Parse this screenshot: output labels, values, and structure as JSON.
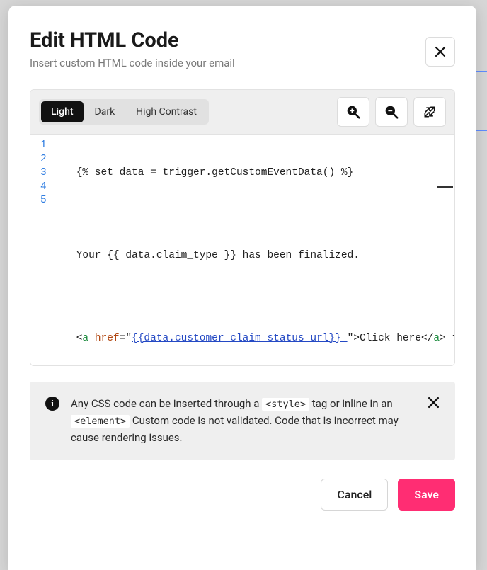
{
  "modal": {
    "title": "Edit HTML Code",
    "subtitle": "Insert custom HTML code inside your email"
  },
  "toolbar": {
    "themes": {
      "light": "Light",
      "dark": "Dark",
      "high_contrast": "High Contrast"
    }
  },
  "code": {
    "line1": "{% set data = trigger.getCustomEventData() %}",
    "line2": "",
    "line3": "Your {{ data.claim_type }} has been finalized.",
    "line4": "",
    "line5": {
      "open_lt": "<",
      "tag_a_open": "a",
      "sp": " ",
      "attr_href": "href",
      "eq_q": "=\"",
      "url": "{{data.customer_claim_status_url}} ",
      "close_q_gt": "\">",
      "link_text": "Click here",
      "close_lt": "</",
      "tag_a_close": "a",
      "gt": ">",
      "tail": " to view"
    },
    "line_numbers": [
      "1",
      "2",
      "3",
      "4",
      "5"
    ]
  },
  "info": {
    "pre": "Any CSS code can be inserted through a ",
    "code1": "<style>",
    "mid": " tag or inline in an ",
    "code2": "<element>",
    "post": " Custom code is not validated. Code that is incorrect may cause rendering issues."
  },
  "footer": {
    "cancel": "Cancel",
    "save": "Save"
  }
}
